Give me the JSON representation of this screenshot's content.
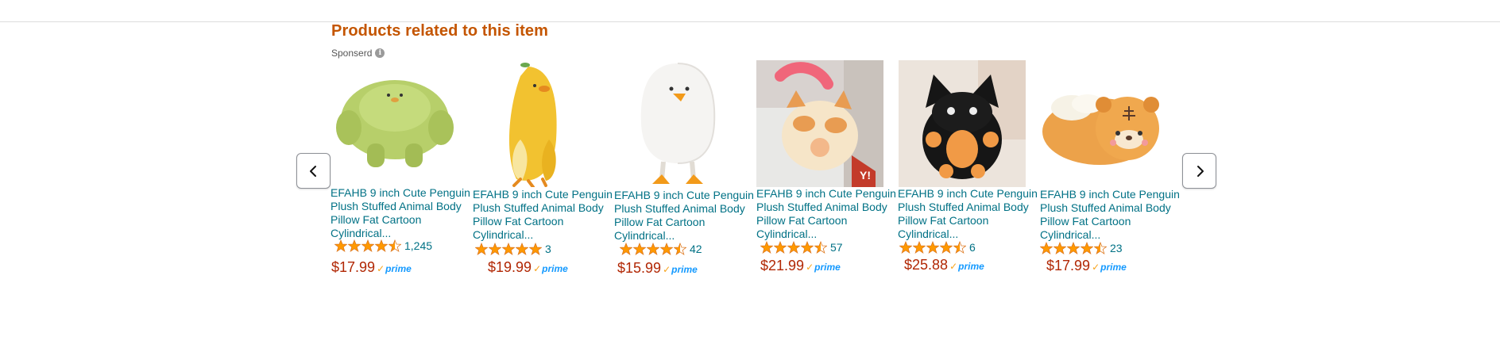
{
  "section": {
    "title": "Products related to this item",
    "sponsored_label": "Sponserd",
    "info_icon": "i"
  },
  "carousel": {
    "prev_icon": "chevron-left-icon",
    "next_icon": "chevron-right-icon"
  },
  "colors": {
    "title": "#c45500",
    "link": "#007185",
    "price": "#b12704",
    "star": "#ff9900",
    "prime": "#1399ff"
  },
  "products": [
    {
      "image": "green-plush-blob",
      "title_lines": [
        "EFAHB 9 inch Cute Penguin",
        "Plush Stuffed Animal Body",
        "Pillow Fat Cartoon",
        "Cylindrical..."
      ],
      "rating": 4.5,
      "rating_count": "1,245",
      "price": "$17.99",
      "prime": "prime"
    },
    {
      "image": "banana-duck-plush",
      "title_lines": [
        "EFAHB 9 inch Cute Penguin",
        "Plush Stuffed Animal Body",
        "Pillow Fat Cartoon",
        "Cylindrical..."
      ],
      "rating": 5,
      "rating_count": "3",
      "price": "$19.99",
      "prime": "prime"
    },
    {
      "image": "white-duck-plush",
      "title_lines": [
        "EFAHB 9 inch Cute Penguin",
        "Plush Stuffed Animal Body",
        "Pillow Fat Cartoon",
        "Cylindrical..."
      ],
      "rating": 4.5,
      "rating_count": "42",
      "price": "$15.99",
      "prime": "prime"
    },
    {
      "image": "cat-plush-held",
      "title_lines": [
        "EFAHB 9 inch Cute Penguin",
        "Plush Stuffed Animal Body",
        "Pillow Fat Cartoon",
        "Cylindrical..."
      ],
      "rating": 4.5,
      "rating_count": "57",
      "price": "$21.99",
      "prime": "prime"
    },
    {
      "image": "black-cat-plush",
      "title_lines": [
        "EFAHB 9 inch Cute Penguin",
        "Plush Stuffed Animal Body",
        "Pillow Fat Cartoon",
        "Cylindrical..."
      ],
      "rating": 4.5,
      "rating_count": "6",
      "price": "$25.88",
      "prime": "prime"
    },
    {
      "image": "tiger-plush-pillow",
      "title_lines": [
        "EFAHB 9 inch Cute Penguin",
        "Plush Stuffed Animal Body",
        "Pillow Fat Cartoon",
        "Cylindrical..."
      ],
      "rating": 4.5,
      "rating_count": "23",
      "price": "$17.99",
      "prime": "prime"
    }
  ]
}
